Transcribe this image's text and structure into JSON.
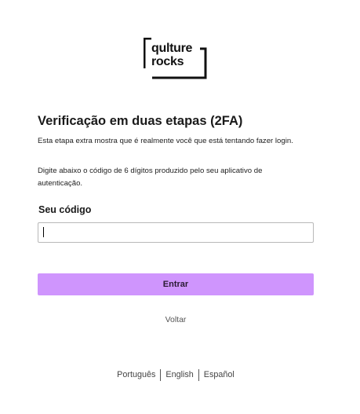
{
  "brand": {
    "logo_line1": "qulture",
    "logo_line2": "rocks"
  },
  "page": {
    "title": "Verificação em duas etapas (2FA)",
    "paragraph1": "Esta etapa extra mostra que é realmente você que está tentando fazer login.",
    "paragraph2": "Digite abaixo o código de 6 dígitos produzido pelo seu aplicativo de autenticação."
  },
  "form": {
    "code_label": "Seu código",
    "code_value": "",
    "code_placeholder": "",
    "submit_label": "Entrar",
    "back_label": "Voltar"
  },
  "languages": [
    {
      "label": "Português"
    },
    {
      "label": "English"
    },
    {
      "label": "Español"
    }
  ],
  "colors": {
    "primary_button": "#cf95fd",
    "text": "#1a1a1a",
    "input_border": "#b8b8b8"
  }
}
